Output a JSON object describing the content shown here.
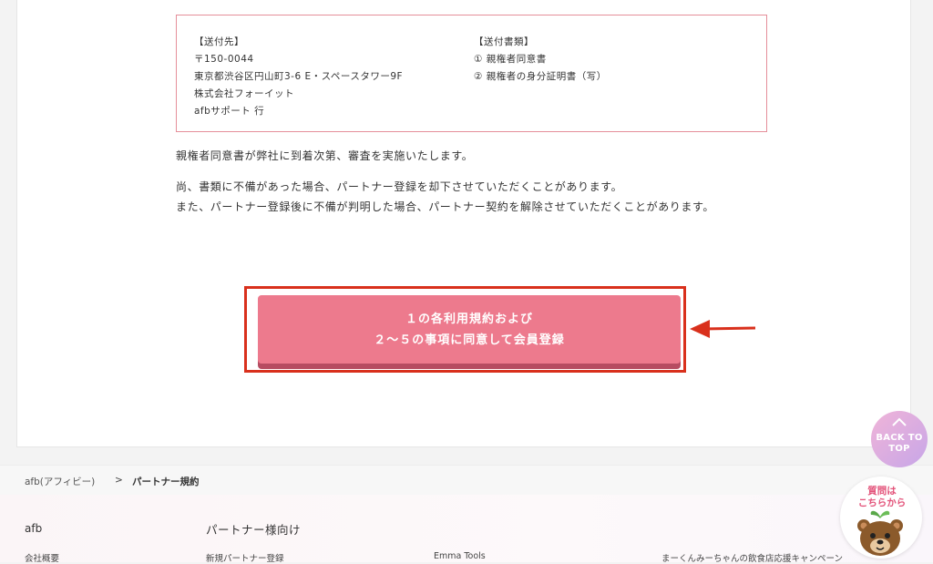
{
  "address_box": {
    "left_heading": "【送付先】",
    "postal": "〒150-0044",
    "address": "東京都渋谷区円山町3-6 E・スペースタワー9F",
    "company": "株式会社フォーイット",
    "recipient": "afbサポート 行",
    "right_heading": "【送付書類】",
    "doc1": "① 親権者同意書",
    "doc2": "② 親権者の身分証明書（写）"
  },
  "body": {
    "line1": "親権者同意書が弊社に到着次第、審査を実施いたします。",
    "line2": "尚、書類に不備があった場合、パートナー登録を却下させていただくことがあります。",
    "line3": "また、パートナー登録後に不備が判明した場合、パートナー契約を解除させていただくことがあります。"
  },
  "cta": {
    "line1": "１の各利用規約および",
    "line2": "２～５の事項に同意して会員登録"
  },
  "breadcrumb": {
    "home": "afb(アフィビー)",
    "separator": ">",
    "current": "パートナー規約"
  },
  "footer": {
    "brand": "afb",
    "partner_heading": "パートナー様向け",
    "links": [
      "会社概要",
      "新規パートナー登録",
      "Emma Tools",
      "まーくんみーちゃんの飲食店応援キャンペーン"
    ]
  },
  "back_to_top": {
    "line1": "BACK TO",
    "line2": "TOP"
  },
  "faq": {
    "line1": "質問は",
    "line2": "こちらから"
  },
  "colors": {
    "cta_fill": "#ed7a8d",
    "cta_shadow": "#b64c61",
    "highlight_frame": "#d9301c",
    "box_border": "#e58e9a"
  },
  "icons": [
    "arrow-left-icon",
    "chevron-up-icon",
    "bear-mascot-icon"
  ]
}
